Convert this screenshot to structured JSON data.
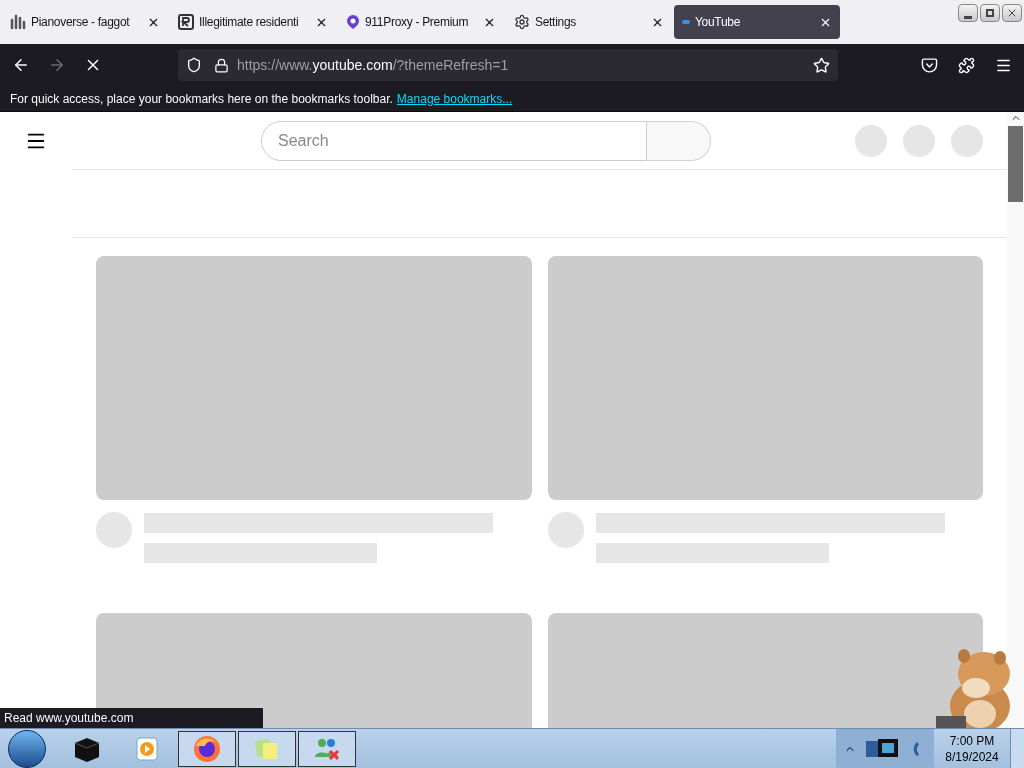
{
  "tabs": [
    {
      "kind": "waves",
      "title": "Pianoverse - faggot",
      "selected": false
    },
    {
      "kind": "square",
      "title": "Illegitimate residenti",
      "selected": false
    },
    {
      "kind": "pin",
      "title": "911Proxy - Premium",
      "selected": false
    },
    {
      "kind": "gear",
      "title": "Settings",
      "selected": false
    },
    {
      "kind": "dot",
      "title": "YouTube",
      "selected": true
    }
  ],
  "address": {
    "prefix": "https://www.",
    "domain": "youtube.com",
    "rest": "/?themeRefresh=1"
  },
  "bookmarks_bar": {
    "message": "For quick access, place your bookmarks here on the bookmarks toolbar.",
    "link": "Manage bookmarks..."
  },
  "page": {
    "search": {
      "placeholder": "Search"
    }
  },
  "status": "Read www.youtube.com",
  "taskbar": {
    "apps": [
      {
        "kind": "box"
      },
      {
        "kind": "player"
      },
      {
        "kind": "firefox"
      },
      {
        "kind": "notes"
      },
      {
        "kind": "people"
      }
    ],
    "time": "7:00 PM",
    "date": "8/19/2024"
  }
}
